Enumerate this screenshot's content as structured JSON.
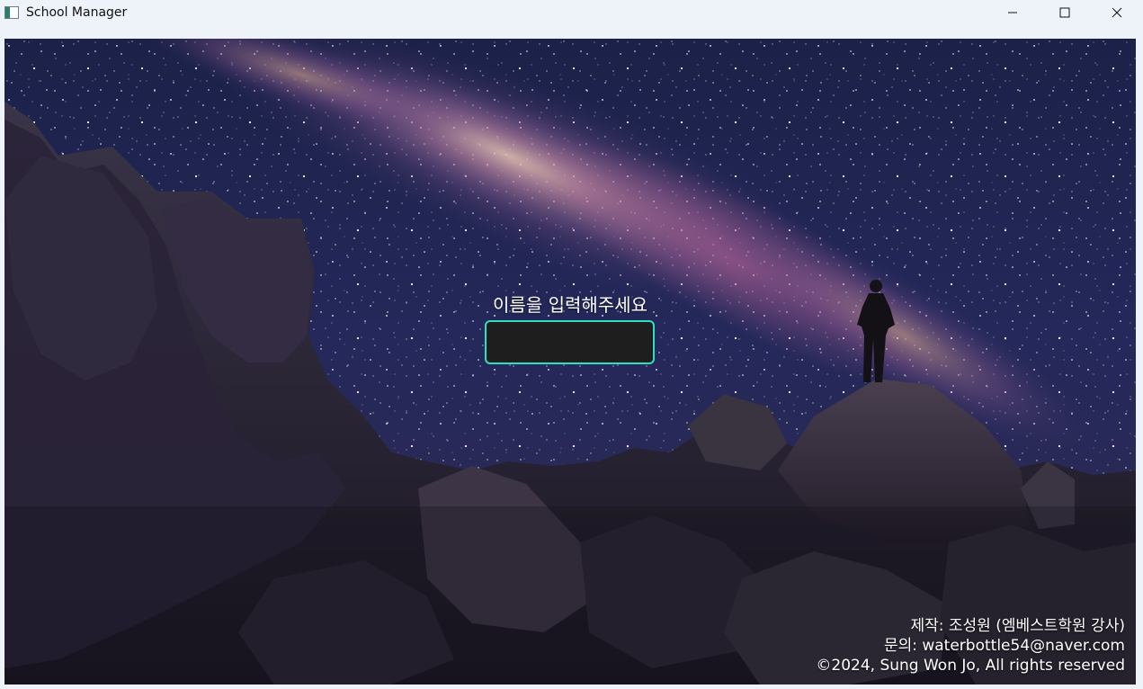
{
  "window": {
    "title": "School Manager",
    "icon": "app-window-icon",
    "controls": {
      "minimize_icon": "minimize-icon",
      "maximize_icon": "maximize-icon",
      "close_icon": "close-icon"
    }
  },
  "main": {
    "prompt_label": "이름을 입력해주세요",
    "name_input": {
      "value": "",
      "placeholder": ""
    },
    "background": "starry-night-milky-way-mountain-photo"
  },
  "credits": {
    "author": "제작: 조성원 (엠베스트학원 강사)",
    "contact": "문의: waterbottle54@naver.com",
    "copyright": "©2024, Sung Won Jo, All rights reserved"
  },
  "colors": {
    "input_border": "#2fe0c0",
    "input_background": "#1e1e1e",
    "titlebar": "#eef2f9"
  }
}
